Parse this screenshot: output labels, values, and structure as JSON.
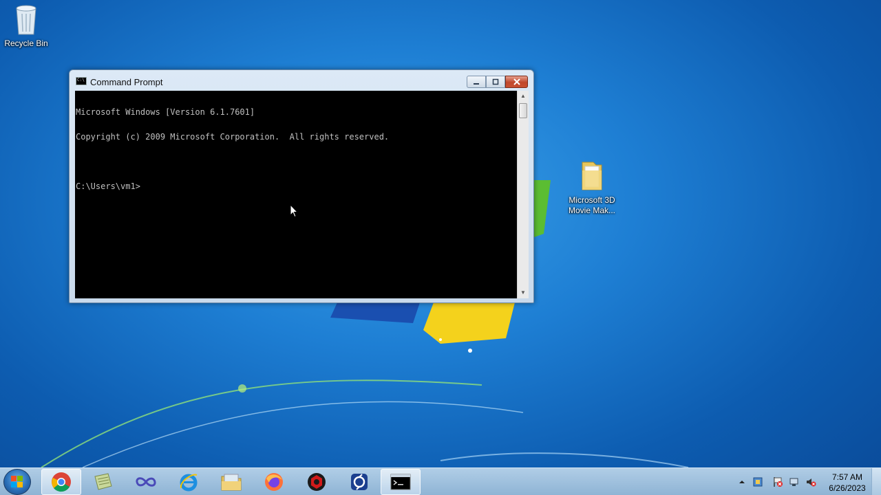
{
  "desktop": {
    "icons": [
      {
        "label": "Recycle Bin",
        "icon": "recycle-bin-icon"
      },
      {
        "label": "Microsoft 3D Movie Mak...",
        "icon": "folder-icon"
      }
    ]
  },
  "cmd_window": {
    "title": "Command Prompt",
    "console_lines": [
      "Microsoft Windows [Version 6.1.7601]",
      "Copyright (c) 2009 Microsoft Corporation.  All rights reserved.",
      "",
      "C:\\Users\\vm1>"
    ]
  },
  "taskbar": {
    "items": [
      {
        "icon": "chrome-icon",
        "active": true
      },
      {
        "icon": "notepad-icon"
      },
      {
        "icon": "infinity-app-icon"
      },
      {
        "icon": "internet-explorer-icon"
      },
      {
        "icon": "file-explorer-icon"
      },
      {
        "icon": "firefox-icon"
      },
      {
        "icon": "red-app-icon"
      },
      {
        "icon": "blue-app-icon"
      },
      {
        "icon": "command-prompt-icon",
        "active": true
      }
    ],
    "tray_icons": [
      "show-hidden-icons-icon",
      "network-app-icon",
      "action-center-icon",
      "network-icon",
      "volume-muted-icon"
    ],
    "clock": {
      "time": "7:57 AM",
      "date": "6/26/2023"
    }
  },
  "colors": {
    "desktop_blue": "#1e7fd4",
    "console_bg": "#000000",
    "console_text": "#c0c0c0",
    "close_red": "#c94f30"
  }
}
